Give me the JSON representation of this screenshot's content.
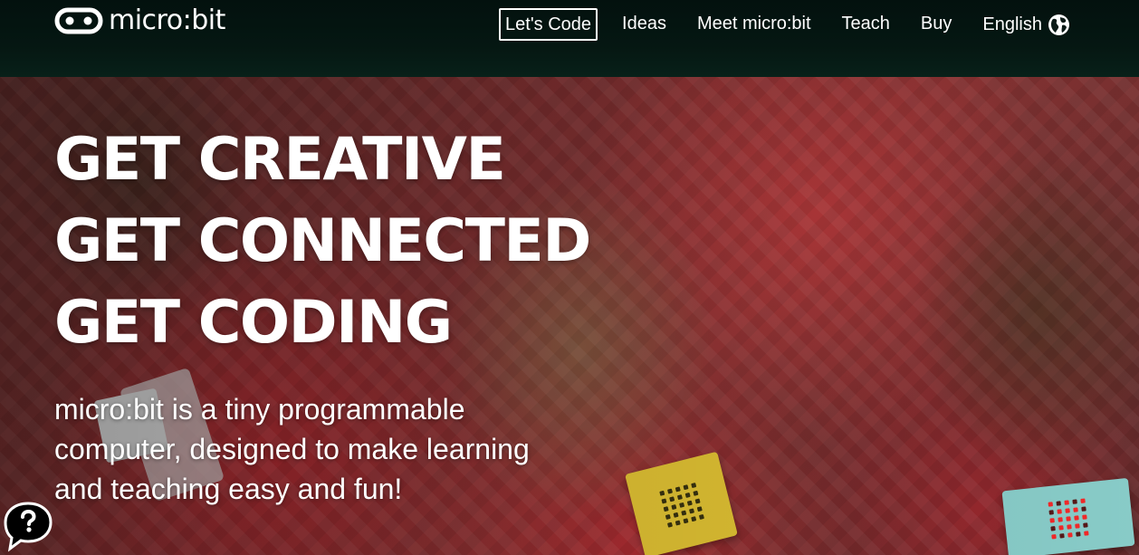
{
  "header": {
    "logo_text": "micro:bit",
    "nav": [
      {
        "label": "Let's Code"
      },
      {
        "label": "Ideas"
      },
      {
        "label": "Meet micro:bit"
      },
      {
        "label": "Teach"
      },
      {
        "label": "Buy"
      },
      {
        "label": "English"
      }
    ]
  },
  "hero": {
    "headline": [
      "GET CREATIVE",
      "GET CONNECTED",
      "GET CODING"
    ],
    "subtext": "micro:bit is a tiny programmable computer, designed to make learning and teaching easy and fun!"
  },
  "icons": {
    "logo": "microbit-logo-icon",
    "language": "globe-icon",
    "feedback": "help-chat-icon"
  },
  "colors": {
    "header_bg": "#051712",
    "text": "#ffffff",
    "device_yellow": "#e9c935",
    "device_teal": "#8fd6d2",
    "led_red": "#ff2a2a"
  }
}
